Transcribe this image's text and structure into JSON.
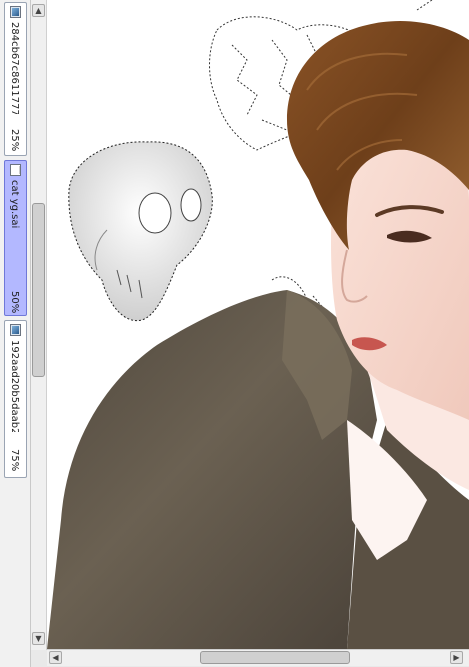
{
  "documents": [
    {
      "name": "284cb67c8611777...",
      "zoom": "25%",
      "active": false,
      "icon": "image-file-icon"
    },
    {
      "name": "cat yg.sai",
      "zoom": "50%",
      "active": true,
      "icon": "blank-file-icon"
    },
    {
      "name": "192aad20b5daab2...",
      "zoom": "75%",
      "active": false,
      "icon": "image-file-icon"
    }
  ],
  "colors": {
    "active_tab": "#b3b8ff",
    "coat": "#5e5446",
    "hair": "#7a4a22",
    "skin": "#f6d9cf",
    "canvas_bg": "#ffffff"
  },
  "scroll": {
    "vertical_fraction": 0.43,
    "horizontal_fraction": 0.45
  }
}
